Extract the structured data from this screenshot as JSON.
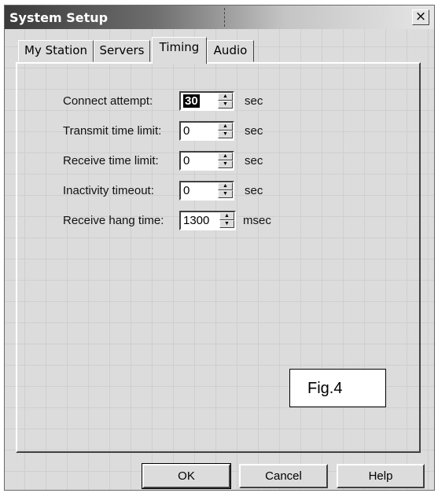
{
  "window": {
    "title": "System Setup",
    "close_glyph": "×"
  },
  "tabs": [
    {
      "label": "My Station",
      "active": false
    },
    {
      "label": "Servers",
      "active": false
    },
    {
      "label": "Timing",
      "active": true
    },
    {
      "label": "Audio",
      "active": false
    }
  ],
  "fields": [
    {
      "label": "Connect attempt:",
      "value": "30",
      "unit": "sec",
      "selected": true
    },
    {
      "label": "Transmit time limit:",
      "value": "0",
      "unit": "sec"
    },
    {
      "label": "Receive time limit:",
      "value": "0",
      "unit": "sec"
    },
    {
      "label": "Inactivity timeout:",
      "value": "0",
      "unit": "sec"
    },
    {
      "label": "Receive hang time:",
      "value": "1300",
      "unit": "msec"
    }
  ],
  "figure_label": "Fig.4",
  "buttons": {
    "ok": "OK",
    "cancel": "Cancel",
    "help": "Help"
  },
  "icons": {
    "close": "close-icon",
    "spin_up": "triangle-up-icon",
    "spin_down": "triangle-down-icon"
  }
}
